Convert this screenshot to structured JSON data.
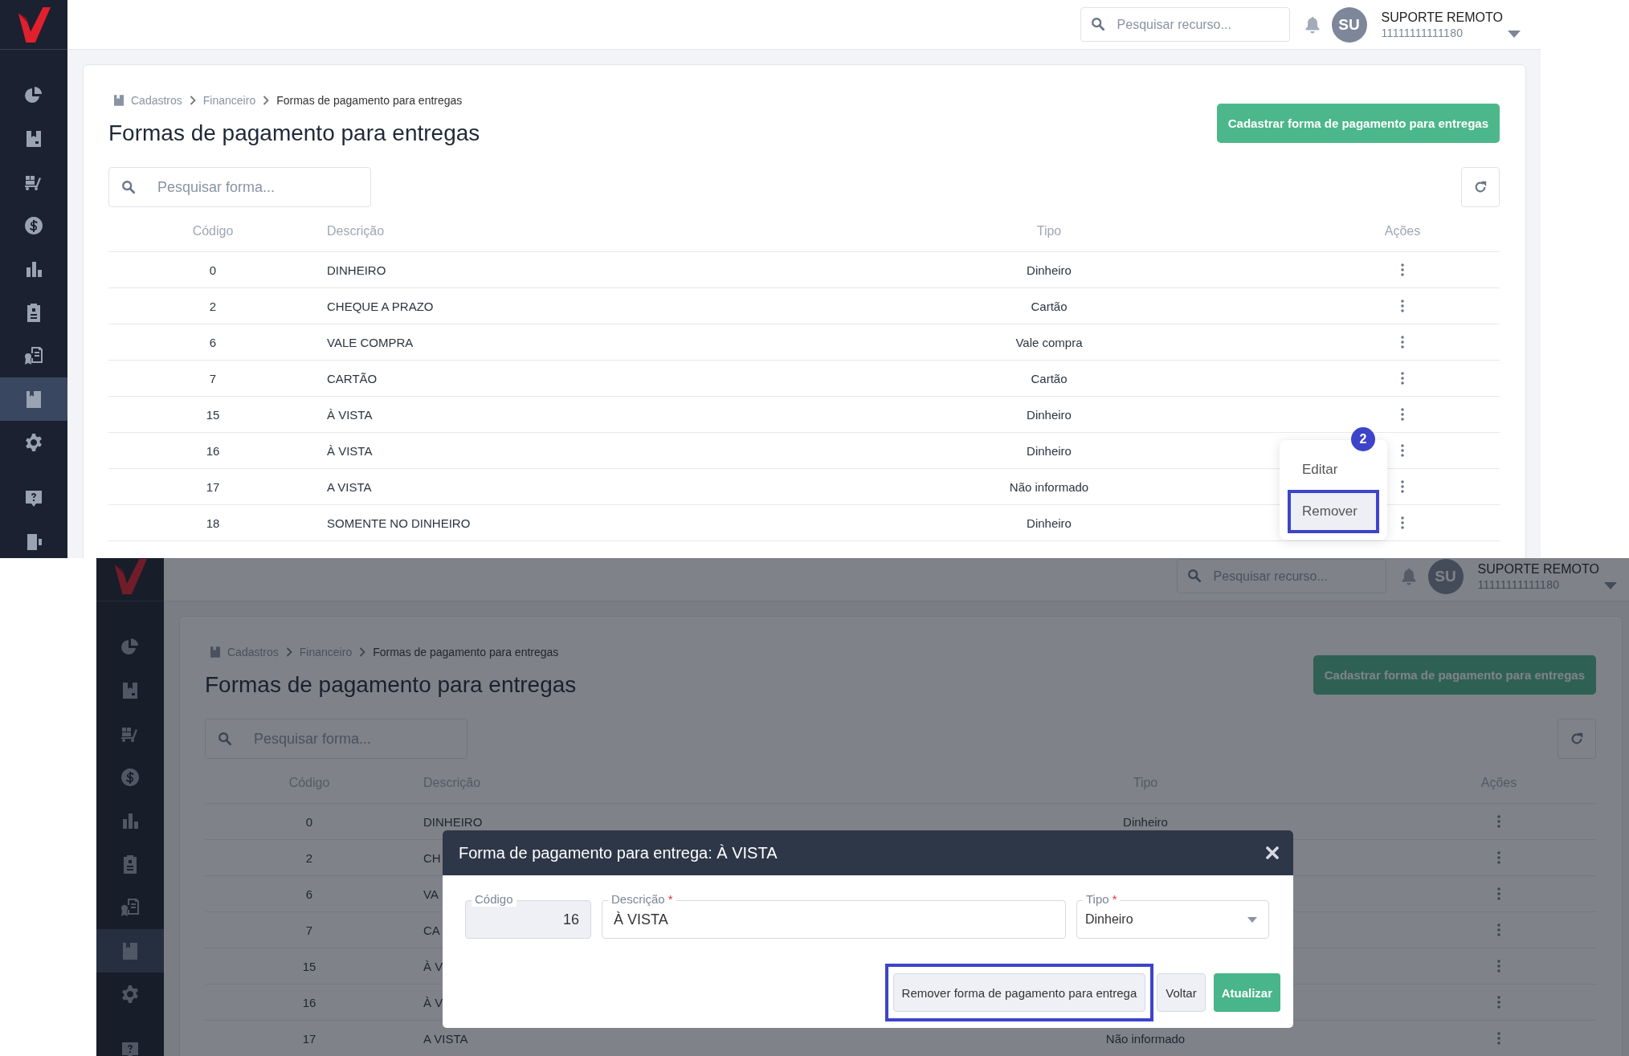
{
  "screens": [
    {
      "sidebar": [
        {
          "kind": "pie",
          "selected": false
        },
        {
          "kind": "save",
          "selected": false
        },
        {
          "kind": "dolly",
          "selected": false
        },
        {
          "kind": "dollar",
          "selected": false
        },
        {
          "kind": "bars",
          "selected": false
        },
        {
          "kind": "clipboard",
          "selected": false
        },
        {
          "kind": "certificate",
          "selected": false
        },
        {
          "kind": "book",
          "selected": true
        },
        {
          "kind": "gear",
          "selected": false
        },
        {
          "kind": "help",
          "selected": false
        },
        {
          "kind": "exit",
          "selected": false
        }
      ],
      "header": {
        "search_placeholder": "Pesquisar recurso...",
        "avatar": "SU",
        "user_name": "SUPORTE REMOTO",
        "user_id": "11111111111180"
      },
      "breadcrumb": [
        "Cadastros",
        "Financeiro",
        "Formas de pagamento para entregas"
      ],
      "title": "Formas de pagamento para entregas",
      "new_button": "Cadastrar forma de pagamento para entregas",
      "search": {
        "placeholder": "Pesquisar forma..."
      },
      "table": {
        "columns": [
          "Código",
          "Descrição",
          "Tipo",
          "Ações"
        ],
        "rows": [
          {
            "code": "0",
            "description": "DINHEIRO",
            "type": "Dinheiro"
          },
          {
            "code": "2",
            "description": "CHEQUE A PRAZO",
            "type": "Cartão"
          },
          {
            "code": "6",
            "description": "VALE COMPRA",
            "type": "Vale compra"
          },
          {
            "code": "7",
            "description": "CARTÃO",
            "type": "Cartão"
          },
          {
            "code": "15",
            "description": "À VISTA",
            "type": "Dinheiro"
          },
          {
            "code": "16",
            "description": "À VISTA",
            "type": "Dinheiro"
          },
          {
            "code": "17",
            "description": "A VISTA",
            "type": "Não informado"
          },
          {
            "code": "18",
            "description": "SOMENTE NO DINHEIRO",
            "type": "Dinheiro"
          }
        ]
      },
      "row_menu": {
        "step": "2",
        "items": [
          {
            "label": "Editar",
            "highlighted": false
          },
          {
            "label": "Remover",
            "highlighted": true
          }
        ]
      }
    },
    {
      "sidebar": [
        {
          "kind": "pie",
          "selected": false
        },
        {
          "kind": "save",
          "selected": false
        },
        {
          "kind": "dolly",
          "selected": false
        },
        {
          "kind": "dollar",
          "selected": false
        },
        {
          "kind": "bars",
          "selected": false
        },
        {
          "kind": "clipboard",
          "selected": false
        },
        {
          "kind": "certificate",
          "selected": false
        },
        {
          "kind": "book",
          "selected": true
        },
        {
          "kind": "gear",
          "selected": false
        },
        {
          "kind": "help",
          "selected": false
        }
      ],
      "header": {
        "search_placeholder": "Pesquisar recurso...",
        "avatar": "SU",
        "user_name": "SUPORTE REMOTO",
        "user_id": "11111111111180"
      },
      "breadcrumb": [
        "Cadastros",
        "Financeiro",
        "Formas de pagamento para entregas"
      ],
      "title": "Formas de pagamento para entregas",
      "new_button": "Cadastrar forma de pagamento para entregas",
      "search": {
        "placeholder": "Pesquisar forma..."
      },
      "table": {
        "columns": [
          "Código",
          "Descrição",
          "Tipo",
          "Ações"
        ],
        "rows": [
          {
            "code": "0",
            "description": "DINHEIRO",
            "type": "Dinheiro"
          },
          {
            "code": "2",
            "description": "CH"
          },
          {
            "code": "6",
            "description": "VA"
          },
          {
            "code": "7",
            "description": "CA"
          },
          {
            "code": "15",
            "description": "À V"
          },
          {
            "code": "16",
            "description": "À V"
          },
          {
            "code": "17",
            "description": "A VISTA",
            "type": "Não informado"
          }
        ]
      },
      "modal": {
        "title": "Forma de pagamento para entrega: À VISTA",
        "fields": [
          {
            "kind": "readonly",
            "label": "Código",
            "value": "16"
          },
          {
            "kind": "text",
            "label": "Descrição",
            "required_mark": "*",
            "value": "À VISTA"
          },
          {
            "kind": "select",
            "label": "Tipo",
            "required_mark": "*",
            "value": "Dinheiro"
          }
        ],
        "buttons": [
          {
            "kind": "secondary",
            "label": "Remover forma de pagamento para entrega",
            "highlighted": true
          },
          {
            "kind": "secondary",
            "label": "Voltar",
            "highlighted": false
          },
          {
            "kind": "primary",
            "label": "Atualizar",
            "highlighted": false
          }
        ]
      }
    }
  ]
}
